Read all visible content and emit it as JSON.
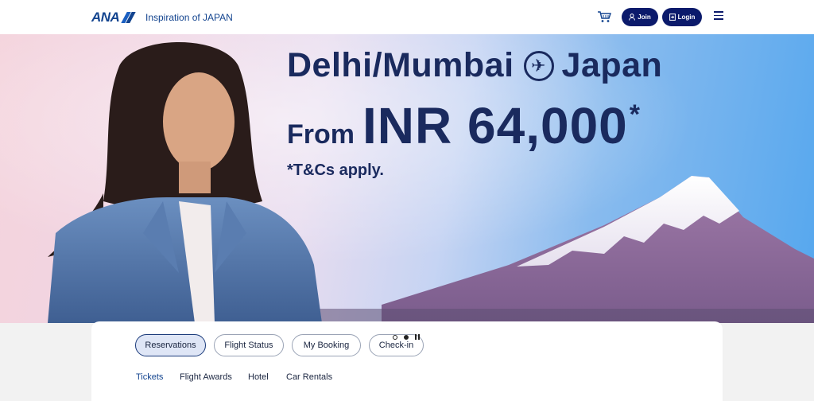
{
  "header": {
    "logo_text": "ANA",
    "tagline": "Inspiration of JAPAN",
    "cart_icon": "cart-icon",
    "join_label": "Join",
    "login_label": "Login",
    "menu_icon": "hamburger-menu-icon"
  },
  "hero": {
    "route_from": "Delhi/Mumbai",
    "route_to": "Japan",
    "from_label": "From",
    "price": "INR 64,000",
    "asterisk": "*",
    "terms": "*T&Cs apply."
  },
  "carousel": {
    "slides": 2,
    "active_index": 1
  },
  "tabs": [
    "Reservations",
    "Flight Status",
    "My Booking",
    "Check-in"
  ],
  "active_tab": "Reservations",
  "subnav": [
    "Tickets",
    "Flight Awards",
    "Hotel",
    "Car Rentals"
  ],
  "colors": {
    "brand_navy": "#0b1a6b",
    "brand_blue": "#13448f",
    "hero_text": "#1a2a5e"
  }
}
